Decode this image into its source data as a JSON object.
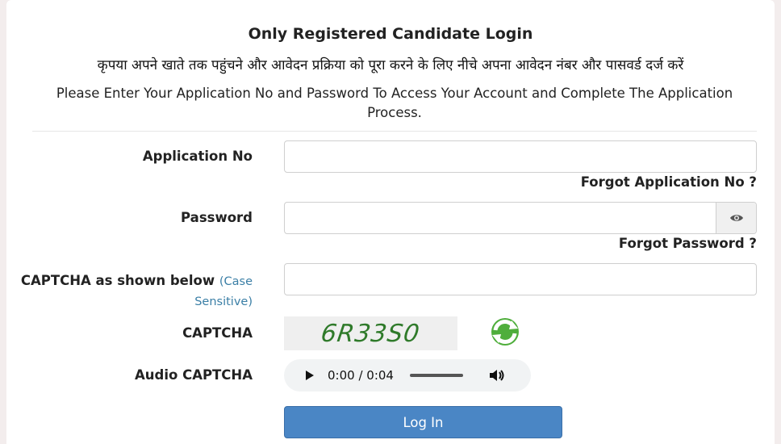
{
  "header": {
    "title": "Only Registered Candidate Login",
    "hindi_instruction": "कृपया अपने खाते तक पहुंचने और आवेदन प्रक्रिया को पूरा करने के लिए नीचे अपना आवेदन नंबर और पासवर्ड दर्ज करें",
    "english_instruction": "Please Enter Your Application No and Password To Access Your Account and Complete The Application Process."
  },
  "form": {
    "application_no": {
      "label": "Application No",
      "value": "",
      "placeholder": ""
    },
    "forgot_application": "Forgot Application No ?",
    "password": {
      "label": "Password",
      "value": "",
      "placeholder": "",
      "toggle_icon": "eye-icon"
    },
    "forgot_password": "Forgot Password ?",
    "captcha_input": {
      "label": "CAPTCHA as shown below",
      "note": "(Case Sensitive)",
      "value": "",
      "placeholder": ""
    },
    "captcha": {
      "label": "CAPTCHA",
      "text": "6R33S0",
      "refresh_icon": "refresh-icon"
    },
    "audio_captcha": {
      "label": "Audio CAPTCHA",
      "time": "0:00 / 0:04",
      "progress": 0
    },
    "login_button": "Log In"
  },
  "colors": {
    "login_button": "#4a86c5",
    "captcha_text": "#2f7a2a",
    "case_note": "#3b7fa6"
  }
}
